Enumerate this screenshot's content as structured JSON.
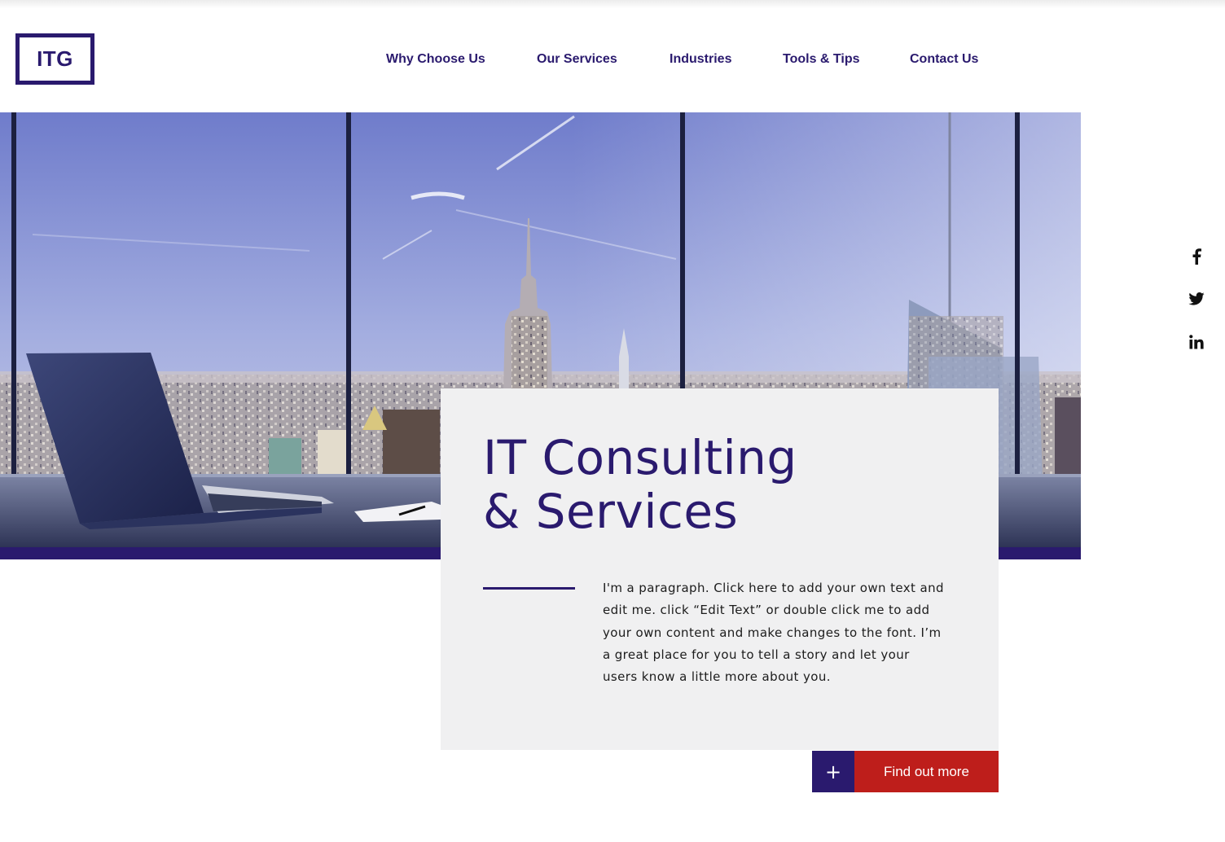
{
  "logo": {
    "text": "ITG"
  },
  "nav": {
    "items": [
      {
        "label": "Why Choose Us"
      },
      {
        "label": "Our Services"
      },
      {
        "label": "Industries"
      },
      {
        "label": "Tools & Tips"
      },
      {
        "label": "Contact Us"
      }
    ]
  },
  "hero": {
    "image": "office-window-city-skyline-with-laptop",
    "title_line1": "IT Consulting",
    "title_line2": "& Services",
    "paragraph": "I'm a paragraph. Click here to add your own text and edit me. click “Edit Text” or double click me to add your own content and make changes to the font. I’m a great place for you to tell a story and let your users know a little more about you."
  },
  "cta": {
    "plus_label": "+",
    "button_label": "Find out more"
  },
  "social": {
    "icons": [
      "facebook-icon",
      "twitter-icon",
      "linkedin-icon"
    ]
  },
  "colors": {
    "brand": "#2a1a6e",
    "cta_red": "#be1e1b",
    "card_bg": "#f0f0f1"
  }
}
